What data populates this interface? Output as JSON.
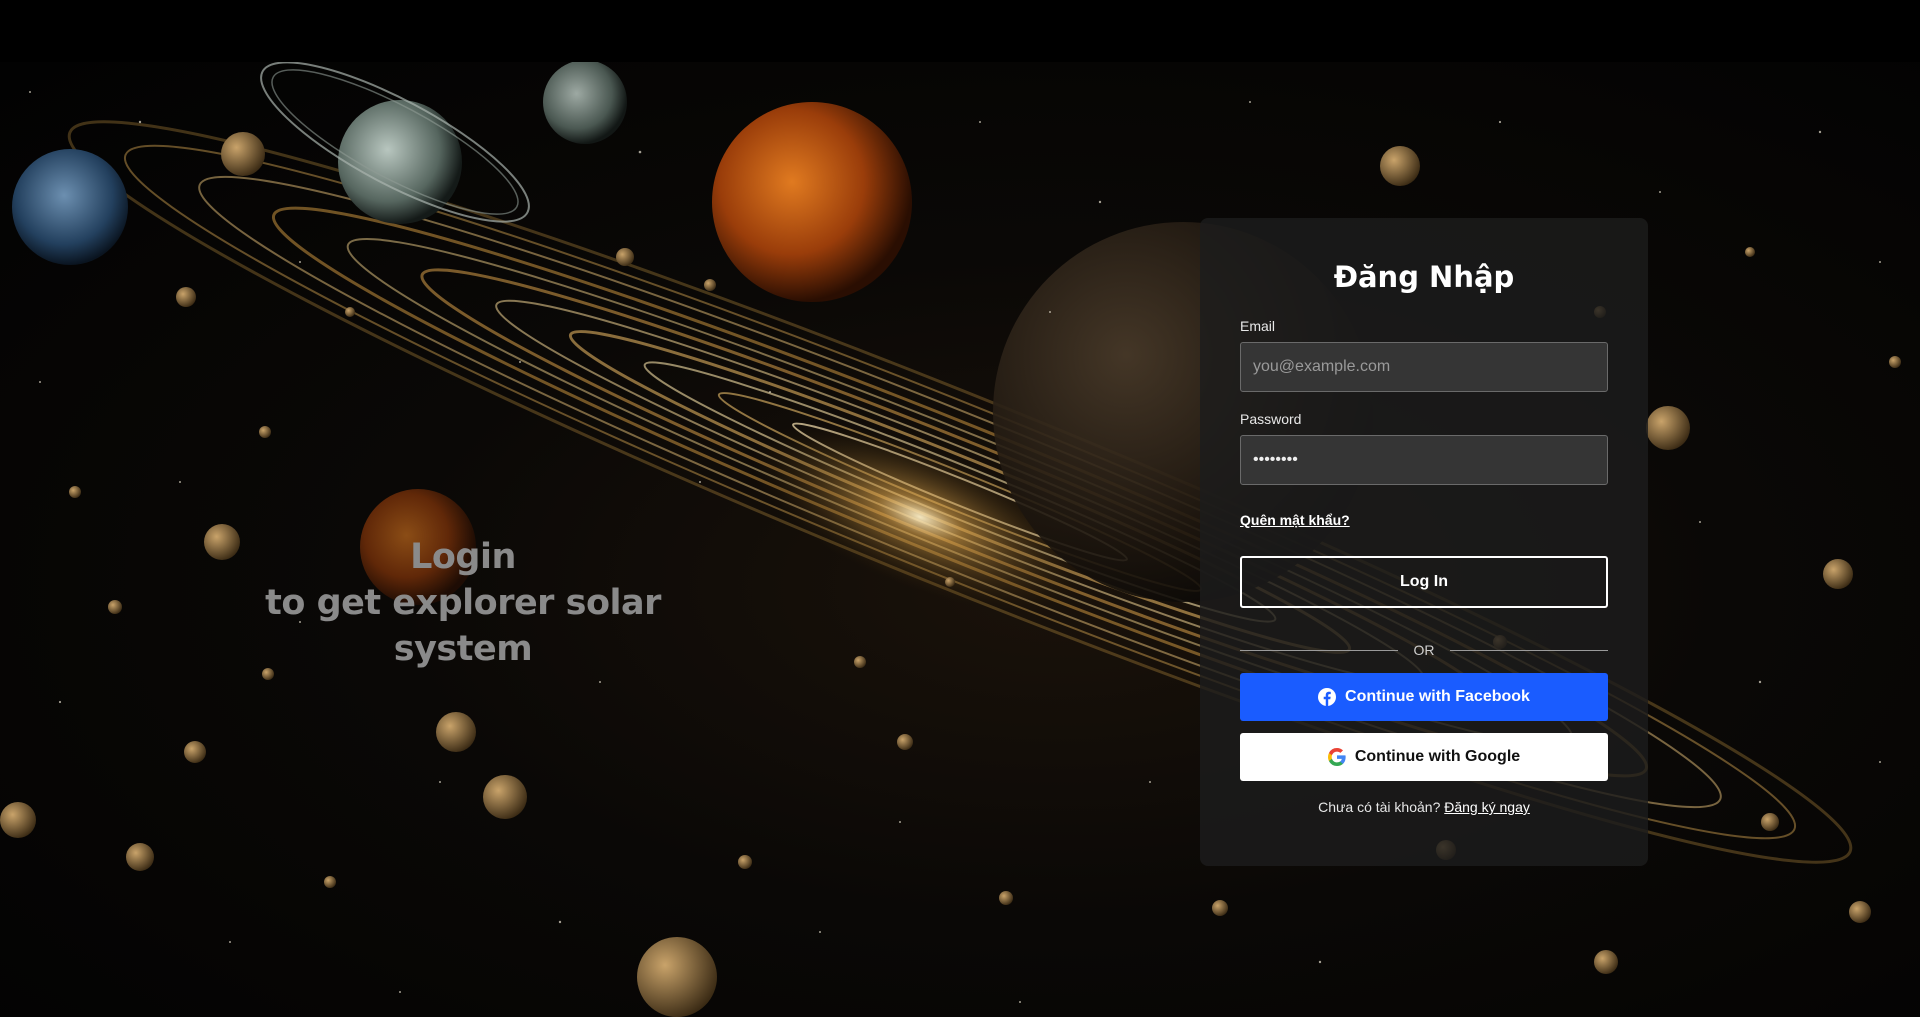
{
  "hero": {
    "line1": "Login",
    "line2": "to get explorer solar",
    "line3": "system"
  },
  "login_card": {
    "title": "Đăng Nhập",
    "email_label": "Email",
    "email_placeholder": "you@example.com",
    "email_value": "",
    "password_label": "Password",
    "password_value": "••••••••",
    "forgot_link": "Quên mật khẩu?",
    "login_button": "Log In",
    "divider_text": "OR",
    "facebook_button": "Continue with Facebook",
    "google_button": "Continue with Google",
    "signup_prompt": "Chưa có tài khoản?",
    "signup_link": "Đăng ký ngay"
  },
  "colors": {
    "facebook": "#1a5cff",
    "google_button_bg": "#ffffff",
    "card_bg": "#1c1c1c"
  },
  "icons": {
    "facebook": "facebook-icon",
    "google": "google-icon"
  }
}
